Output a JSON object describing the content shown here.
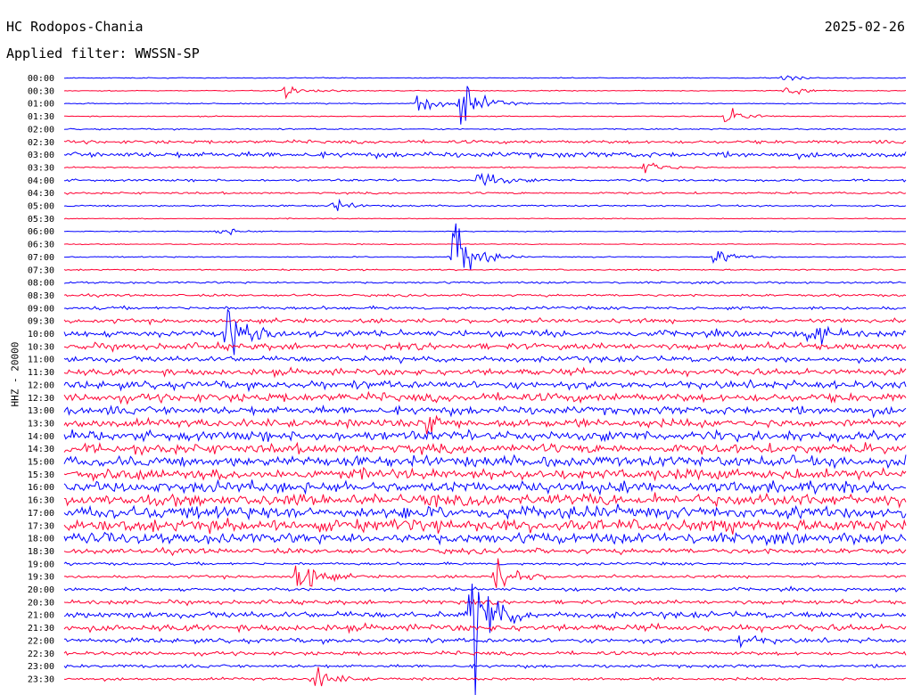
{
  "header": {
    "station": "HC Rodopos-Chania",
    "date": "2025-02-26",
    "filter": "Applied filter: WWSSN-SP"
  },
  "chart_data": {
    "type": "line",
    "title": "HC Rodopos-Chania",
    "ylabel": "HHZ - 20000",
    "rows": [
      "00:00",
      "00:30",
      "01:00",
      "01:30",
      "02:00",
      "02:30",
      "03:00",
      "03:30",
      "04:00",
      "04:30",
      "05:00",
      "05:30",
      "06:00",
      "06:30",
      "07:00",
      "07:30",
      "08:00",
      "08:30",
      "09:00",
      "09:30",
      "10:00",
      "10:30",
      "11:00",
      "11:30",
      "12:00",
      "12:30",
      "13:00",
      "13:30",
      "14:00",
      "14:30",
      "15:00",
      "15:30",
      "16:00",
      "16:30",
      "17:00",
      "17:30",
      "18:00",
      "18:30",
      "19:00",
      "19:30",
      "20:00",
      "20:30",
      "21:00",
      "21:30",
      "22:00",
      "22:30",
      "23:00",
      "23:30"
    ],
    "trace_colors": [
      "#0000ff",
      "#ff0033"
    ],
    "noise_levels": [
      0.4,
      0.4,
      0.5,
      0.4,
      0.6,
      1.4,
      2.4,
      0.6,
      1.0,
      0.9,
      0.7,
      0.4,
      0.4,
      0.4,
      0.5,
      0.6,
      0.9,
      1.0,
      1.4,
      1.8,
      2.6,
      2.8,
      2.4,
      2.8,
      3.4,
      3.6,
      3.6,
      3.6,
      4.2,
      4.2,
      4.4,
      4.6,
      4.8,
      5.0,
      5.2,
      5.2,
      4.6,
      2.2,
      1.2,
      1.2,
      1.4,
      1.8,
      2.6,
      2.8,
      2.0,
      1.6,
      1.4,
      1.2
    ],
    "events": [
      {
        "row": 0,
        "x_min": 25.5,
        "amp": 4
      },
      {
        "row": 1,
        "x_min": 7.8,
        "amp": 8
      },
      {
        "row": 1,
        "x_min": 25.7,
        "amp": 7
      },
      {
        "row": 2,
        "x_min": 12.6,
        "amp": 12
      },
      {
        "row": 2,
        "x_min": 14.1,
        "amp": 28
      },
      {
        "row": 3,
        "x_min": 23.6,
        "amp": 10
      },
      {
        "row": 7,
        "x_min": 20.7,
        "amp": 10
      },
      {
        "row": 8,
        "x_min": 14.8,
        "amp": 12
      },
      {
        "row": 10,
        "x_min": 9.5,
        "amp": 6
      },
      {
        "row": 12,
        "x_min": 5.5,
        "amp": 5
      },
      {
        "row": 14,
        "x_min": 13.9,
        "amp": 40
      },
      {
        "row": 14,
        "x_min": 23.2,
        "amp": 7
      },
      {
        "row": 20,
        "x_min": 5.8,
        "amp": 40
      },
      {
        "row": 20,
        "x_min": 26.5,
        "amp": 12
      },
      {
        "row": 27,
        "x_min": 12.9,
        "amp": 10
      },
      {
        "row": 39,
        "x_min": 8.3,
        "amp": 22
      },
      {
        "row": 39,
        "x_min": 15.4,
        "amp": 18
      },
      {
        "row": 42,
        "x_min": 14.5,
        "amp": 70
      },
      {
        "row": 44,
        "x_min": 24.0,
        "amp": 8
      },
      {
        "row": 47,
        "x_min": 8.9,
        "amp": 14
      }
    ]
  }
}
